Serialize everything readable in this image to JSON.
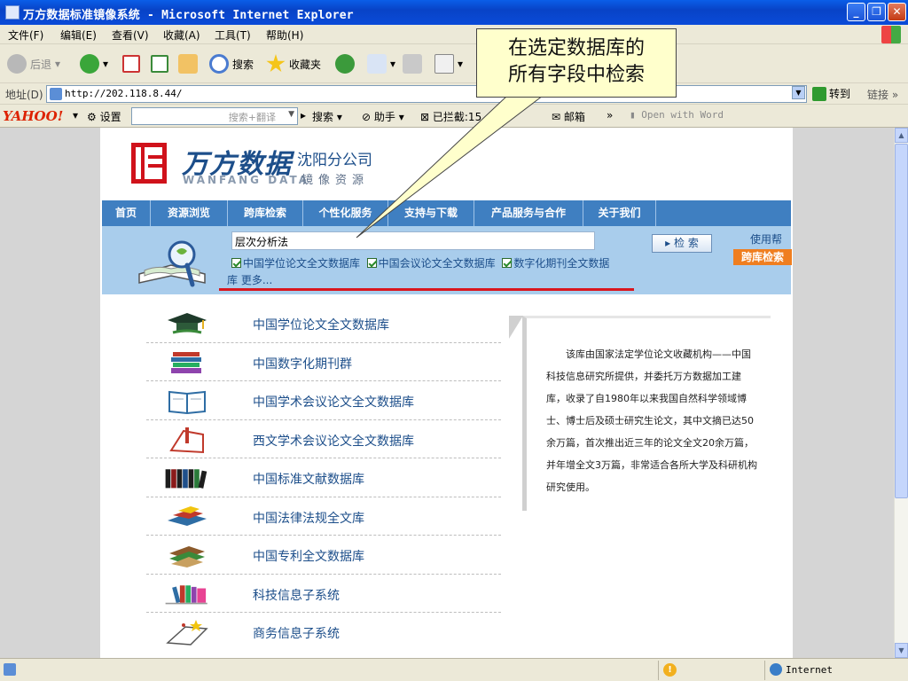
{
  "window": {
    "title": "万方数据标准镜像系统 - Microsoft Internet Explorer",
    "minimize": "_",
    "maximize": "❐",
    "close": "✕"
  },
  "menu": {
    "items": [
      "文件(F)",
      "编辑(E)",
      "查看(V)",
      "收藏(A)",
      "工具(T)",
      "帮助(H)"
    ]
  },
  "toolbar": {
    "back": "后退",
    "search": "搜索",
    "favorites": "收藏夹",
    "dropdown": "▾"
  },
  "addressbar": {
    "label": "地址(D)",
    "url": "http://202.118.8.44/",
    "go": "转到",
    "links": "链接"
  },
  "yahoobar": {
    "logo": "YAHOO!",
    "settings": "设置",
    "search_placeholder": "搜索+翻译",
    "search_button": "搜索",
    "assistant": "助手",
    "blocked": "已拦截:15",
    "mail": "邮箱",
    "more": "»",
    "open_with_word": "Open with Word"
  },
  "site": {
    "logo_cn": "万方数据",
    "logo_en": "WANFANG DATA",
    "branch": "沈阳分公司",
    "mirror": "镜像资源",
    "nav": [
      "首页",
      "资源浏览",
      "跨库检索",
      "个性化服务",
      "支持与下载",
      "产品服务与合作",
      "关于我们"
    ],
    "search": {
      "query": "层次分析法",
      "button": "▸ 检 索",
      "help": "使用帮助",
      "cross_search": "跨库检索",
      "databases": [
        {
          "label": "中国学位论文全文数据库",
          "checked": true
        },
        {
          "label": "中国会议论文全文数据库",
          "checked": true
        },
        {
          "label": "数字化期刊全文数据",
          "checked": true
        }
      ],
      "more_prefix": "库",
      "more": "更多..."
    },
    "db_list": [
      {
        "label": "中国学位论文全文数据库",
        "icon": "graduation-cap-icon"
      },
      {
        "label": "中国数字化期刊群",
        "icon": "book-stack-icon"
      },
      {
        "label": "中国学术会议论文全文数据库",
        "icon": "open-book-icon"
      },
      {
        "label": "西文学术会议论文全文数据库",
        "icon": "bookmark-book-icon"
      },
      {
        "label": "中国标准文献数据库",
        "icon": "binders-icon"
      },
      {
        "label": "中国法律法规全文库",
        "icon": "law-books-icon"
      },
      {
        "label": "中国专利全文数据库",
        "icon": "patent-books-icon"
      },
      {
        "label": "科技信息子系统",
        "icon": "tech-books-icon"
      },
      {
        "label": "商务信息子系统",
        "icon": "business-book-icon"
      }
    ],
    "description": "该库由国家法定学位论文收藏机构——中国科技信息研究所提供，并委托万方数据加工建库，收录了自1980年以来我国自然科学领域博士、博士后及硕士研究生论文，其中文摘已达50余万篇，首次推出近三年的论文全文20余万篇，并年增全文3万篇，非常适合各所大学及科研机构研究使用。"
  },
  "callout": {
    "line1": "在选定数据库的",
    "line2": "所有字段中检索"
  },
  "statusbar": {
    "zone": "Internet"
  },
  "colors": {
    "brand_red": "#d0121b",
    "nav_blue": "#3f7fc1",
    "search_bg": "#a9cdec",
    "cross_button": "#ef7e20",
    "callout_bg": "#ffffcc"
  }
}
